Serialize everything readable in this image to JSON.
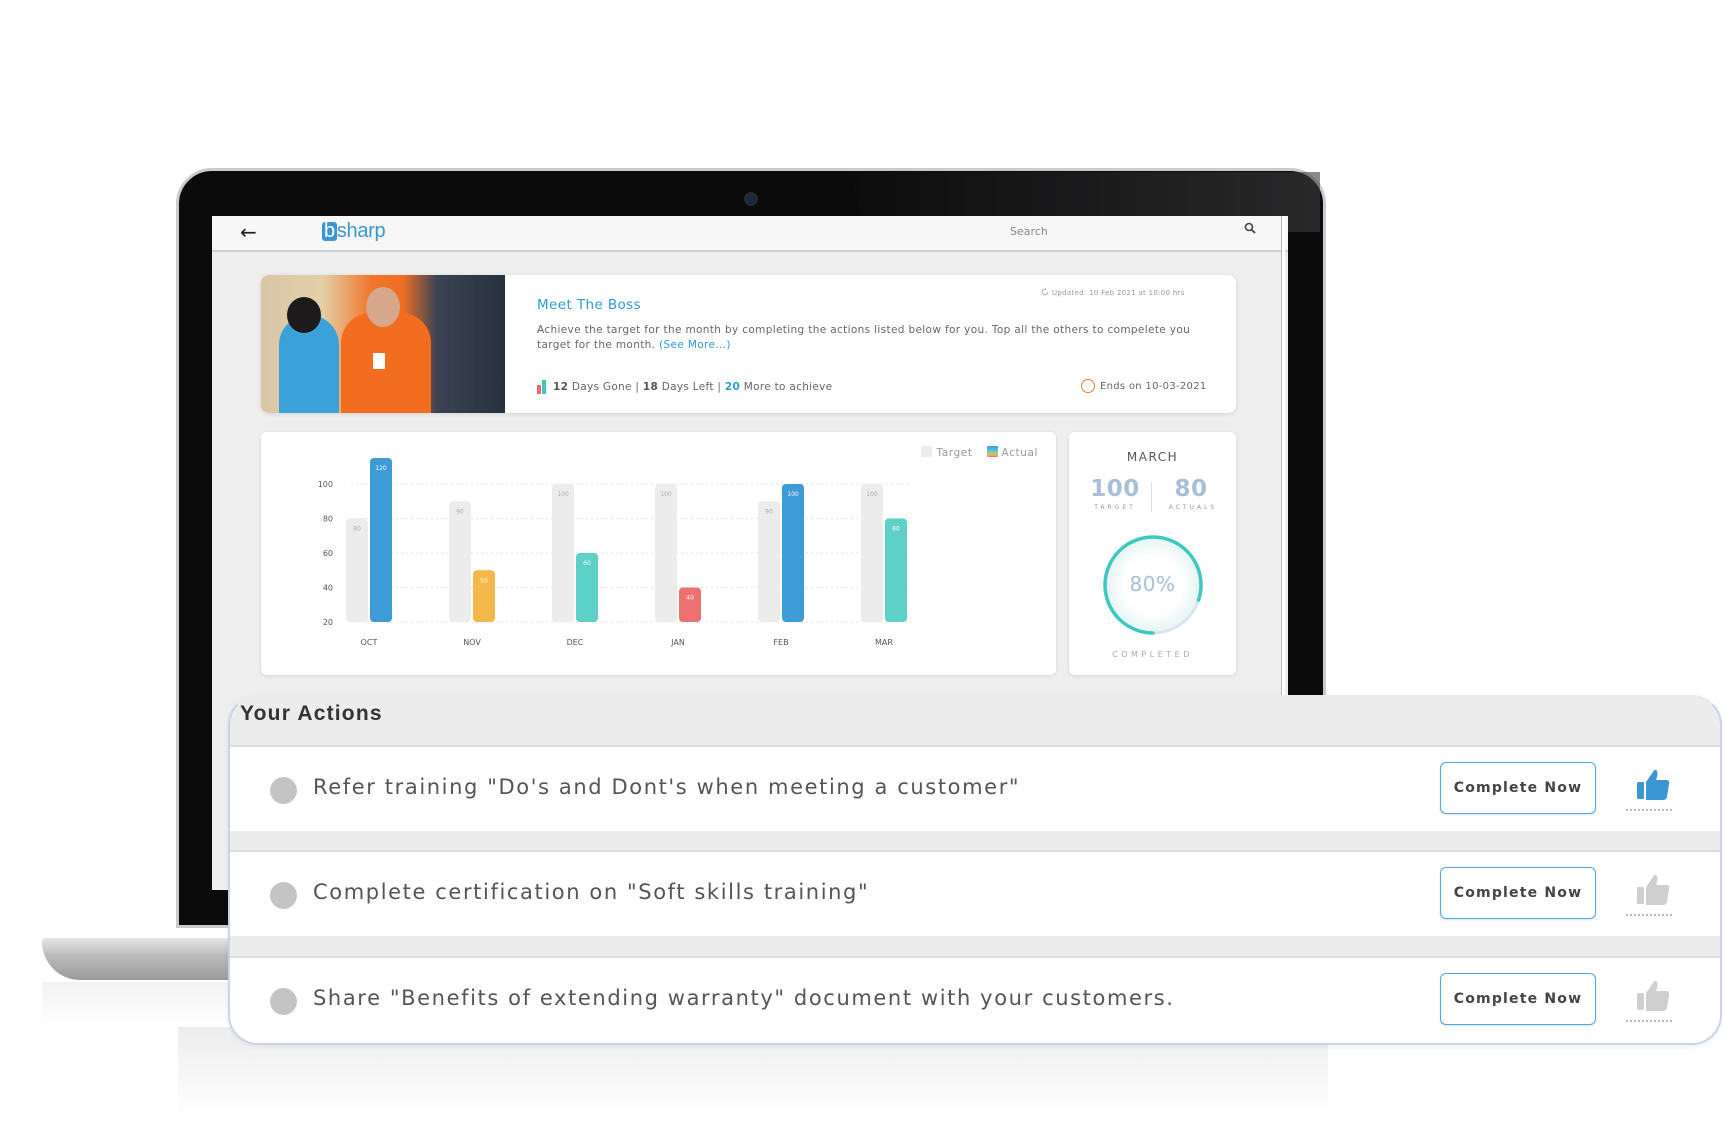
{
  "app": {
    "logo_b": "b",
    "logo_rest": "sharp",
    "back_icon": "arrow-left-icon",
    "search": {
      "placeholder": "Search",
      "icon": "search-icon"
    }
  },
  "hero": {
    "title": "Meet The Boss",
    "description": "Achieve the target for the month by completing the actions listed below for you. Top all the others to compelete you target for the month.",
    "see_more": "(See More...)",
    "updated": "Updated: 10 Feb 2021 at 10:00 hrs",
    "stats": {
      "days_gone_value": "12",
      "days_gone_label": "Days Gone",
      "days_left_value": "18",
      "days_left_label": "Days Left",
      "more_value": "20",
      "more_label": "More to achieve",
      "separator": "|"
    },
    "ends": "Ends on 10-03-2021"
  },
  "chart_data": {
    "type": "bar",
    "title": "",
    "xlabel": "",
    "ylabel": "",
    "categories": [
      "OCT",
      "NOV",
      "DEC",
      "JAN",
      "FEB",
      "MAR"
    ],
    "series": [
      {
        "name": "Target",
        "values": [
          80,
          90,
          100,
          100,
          90,
          100
        ],
        "color": "#ececec"
      },
      {
        "name": "Actual",
        "values": [
          120,
          50,
          60,
          40,
          100,
          80
        ],
        "colors": [
          "#3d9bd6",
          "#f6b84a",
          "#5dd0c8",
          "#ef7070",
          "#3d9bd6",
          "#5dd0c8"
        ]
      }
    ],
    "yticks": [
      20,
      40,
      60,
      80,
      100
    ],
    "ylim": [
      20,
      120
    ],
    "grid": true,
    "legend": "top-right"
  },
  "march": {
    "title": "MARCH",
    "target_value": "100",
    "target_label": "TARGET",
    "actual_value": "80",
    "actual_label": "ACTUALS",
    "percent_label": "80%",
    "percent": 80,
    "completed_label": "COMPLETED",
    "ring_color": "#3ec8bf"
  },
  "actions": {
    "title": "Your Actions",
    "items": [
      {
        "text": "Refer training \"Do's and Dont's when meeting a customer\"",
        "button": "Complete Now",
        "liked": true
      },
      {
        "text": "Complete certification on \"Soft skills training\"",
        "button": "Complete Now",
        "liked": false
      },
      {
        "text": "Share \"Benefits of extending warranty\" document with your customers.",
        "button": "Complete Now",
        "liked": false
      }
    ]
  },
  "colors": {
    "accent": "#2e9ad6",
    "thumb_active": "#3a97d4",
    "thumb_inactive": "#cfcfcf"
  }
}
